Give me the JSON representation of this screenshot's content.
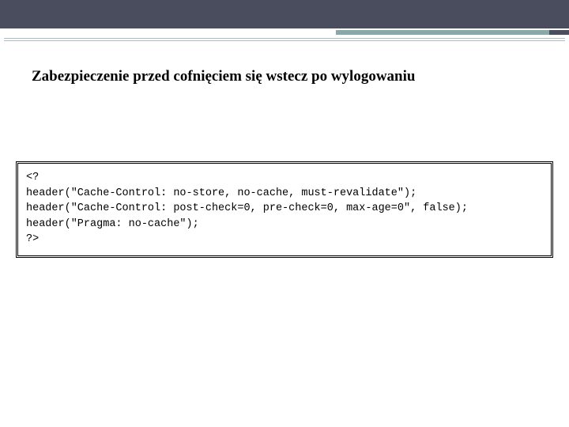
{
  "heading": "Zabezpieczenie przed cofnięciem się wstecz po wylogowaniu",
  "code": "<?\nheader(\"Cache-Control: no-store, no-cache, must-revalidate\");\nheader(\"Cache-Control: post-check=0, pre-check=0, max-age=0\", false);\nheader(\"Pragma: no-cache\");\n?>"
}
